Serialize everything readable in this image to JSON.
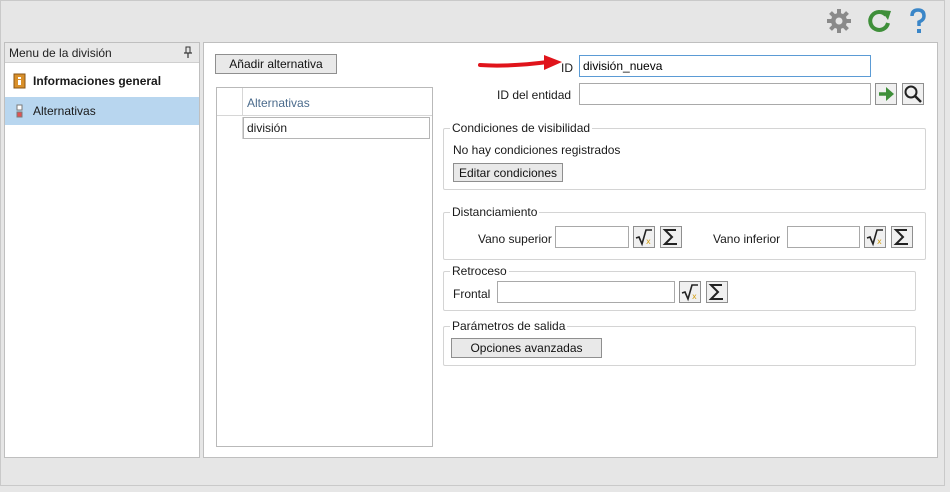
{
  "toolbar": {
    "settings_icon": "gear-icon",
    "refresh_icon": "refresh-icon",
    "help_icon": "help-icon",
    "colors": {
      "gear": "#8a8a8a",
      "refresh": "#3f8f3a",
      "help": "#3a86c8"
    }
  },
  "sidebar": {
    "title": "Menu de la división",
    "items": [
      {
        "label": "Informaciones general",
        "icon": "info-book-icon"
      },
      {
        "label": "Alternativas",
        "icon": "alternatives-icon"
      }
    ]
  },
  "main": {
    "add_alternative_label": "Añadir alternativa",
    "alternatives": {
      "header": "Alternativas",
      "rows": [
        "división"
      ]
    },
    "id_label": "ID",
    "id_value": "división_nueva",
    "entity_label": "ID del entidad",
    "entity_value": "",
    "visibility": {
      "title": "Condiciones de visibilidad",
      "status": "No hay condiciones registrados",
      "edit_label": "Editar condiciones"
    },
    "spacing": {
      "title": "Distanciamiento",
      "upper_label": "Vano superior",
      "upper_value": "",
      "lower_label": "Vano inferior",
      "lower_value": ""
    },
    "setback": {
      "title": "Retroceso",
      "front_label": "Frontal",
      "front_value": ""
    },
    "output": {
      "title": "Parámetros de salida",
      "advanced_label": "Opciones avanzadas"
    },
    "accent_color": "#e0141b"
  }
}
